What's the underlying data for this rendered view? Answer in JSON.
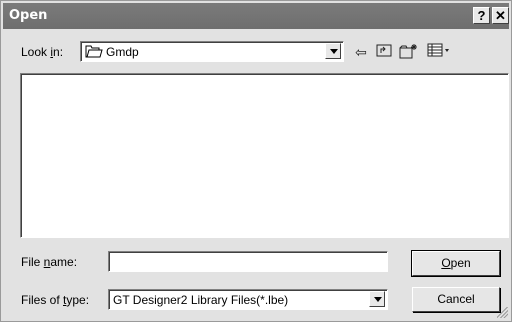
{
  "window": {
    "title": "Open",
    "help_label": "?",
    "close_label": "✕"
  },
  "look_in": {
    "label_pre": "Look ",
    "label_accel": "i",
    "label_post": "n:",
    "value": "Gmdp"
  },
  "toolbar": {
    "back_glyph": "⇦",
    "up_glyph": "⮤",
    "new_folder_glyph": "✳",
    "view_glyph": "▦▾",
    "icons": [
      "back-icon",
      "up-folder-icon",
      "new-folder-icon",
      "view-menu-icon"
    ]
  },
  "file_name": {
    "label_pre": "File ",
    "label_accel": "n",
    "label_post": "ame:",
    "value": ""
  },
  "file_type": {
    "label_pre": "Files of ",
    "label_accel": "t",
    "label_post": "ype:",
    "value": "GT Designer2 Library Files(*.lbe)"
  },
  "buttons": {
    "open_accel": "O",
    "open_rest": "pen",
    "cancel": "Cancel"
  },
  "colors": {
    "titlebar": "#737373",
    "dialog_bg": "#e2e2e2"
  }
}
